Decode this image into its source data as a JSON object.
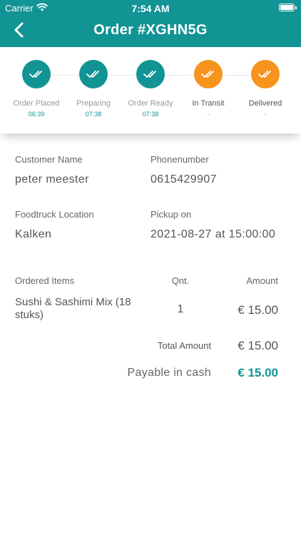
{
  "status_bar": {
    "carrier": "Carrier",
    "time": "7:54 AM"
  },
  "nav": {
    "title": "Order #XGHN5G",
    "back_icon": "chevron-left-icon"
  },
  "colors": {
    "primary": "#129394",
    "accent": "#f7941d"
  },
  "steps": [
    {
      "label": "Order Placed",
      "time": "06:39",
      "state": "done"
    },
    {
      "label": "Preparing",
      "time": "07:38",
      "state": "done"
    },
    {
      "label": "Order Ready",
      "time": "07:38",
      "state": "done"
    },
    {
      "label": "In Transit",
      "time": "-",
      "state": "pending"
    },
    {
      "label": "Delivered",
      "time": "-",
      "state": "pending"
    }
  ],
  "customer": {
    "name_label": "Customer Name",
    "name": "peter meester",
    "phone_label": "Phonenumber",
    "phone": "0615429907"
  },
  "location": {
    "label": "Foodtruck Location",
    "value": "Kalken",
    "pickup_label": "Pickup on",
    "pickup_value": "2021-08-27 at 15:00:00"
  },
  "items": {
    "header_name": "Ordered Items",
    "header_qty": "Qnt.",
    "header_amount": "Amount",
    "rows": [
      {
        "name": "Sushi & Sashimi Mix (18 stuks)",
        "qty": "1",
        "amount": "€ 15.00"
      }
    ]
  },
  "totals": {
    "total_label": "Total Amount",
    "total_value": "€ 15.00",
    "payable_label": "Payable in cash",
    "payable_value": "€ 15.00"
  }
}
